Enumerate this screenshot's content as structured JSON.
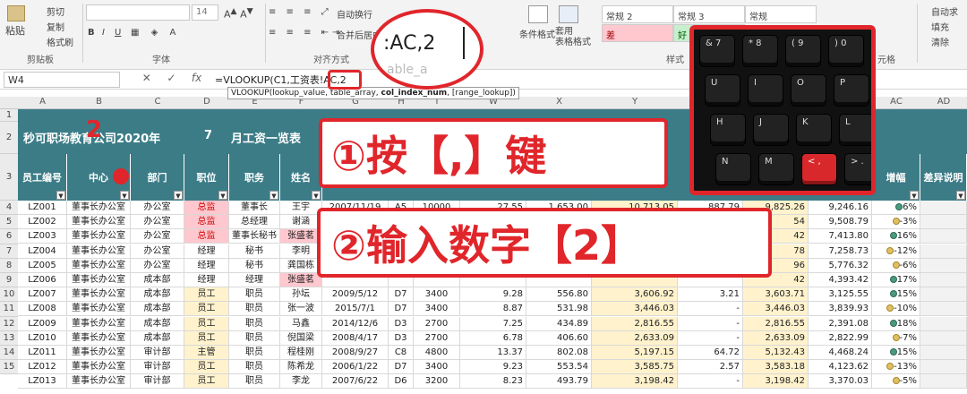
{
  "ribbon": {
    "clipboard": {
      "paste": "粘贴",
      "cut": "剪切",
      "copy": "复制",
      "format": "格式刷",
      "group": "剪贴板"
    },
    "font": {
      "size": "14",
      "group": "字体",
      "bold": "B",
      "italic": "I",
      "underline": "U"
    },
    "align": {
      "wrap": "自动换行",
      "merge": "合并后居中",
      "group": "对齐方式"
    },
    "styles": {
      "cond": "条件格式",
      "table": "套用\n表格格式",
      "normal2": "常规 2",
      "normal3": "常规 3",
      "normal": "常规",
      "bad": "差",
      "good": "好",
      "group": "样式"
    },
    "cells": {
      "autosum": "自动求",
      "fill": "填充",
      "clear": "清除",
      "group": "元格"
    }
  },
  "formula": {
    "namebox": "W4",
    "text": "=VLOOKUP(C1,工资表!AC,2",
    "tooltip_pre": "VLOOKUP(lookup_value, ",
    "tooltip_mid": "table_array, ",
    "tooltip_bold": "col_index_num",
    "tooltip_post": ", [range_lookup])",
    "fx": "fx",
    "cancel": "✕",
    "enter": "✓"
  },
  "columns": [
    "A",
    "B",
    "C",
    "D",
    "E",
    "F",
    "G",
    "H",
    "I",
    "W",
    "X",
    "Y",
    "Z",
    "AA",
    "AB",
    "AC",
    "AD"
  ],
  "row_numbers": [
    "1",
    "2",
    "3",
    "4",
    "5",
    "6",
    "7",
    "8",
    "9",
    "10",
    "11",
    "12",
    "13",
    "14",
    "15"
  ],
  "title": {
    "company": "秒可职场教育公司2020年",
    "month": "7",
    "suffix": "月工资一览表"
  },
  "headers": {
    "id": "员工编号",
    "center": "中心",
    "dept": "部门",
    "post": "职位",
    "duty": "职务",
    "name": "姓名",
    "growth": "增幅",
    "note": "差异说明"
  },
  "rows": [
    [
      "LZ001",
      "董事长办公室",
      "办公室",
      "总监",
      "董事长",
      "王宇",
      "2007/11/19",
      "A5",
      "10000",
      "27.55",
      "1,653.00",
      "10,713.05",
      "887.79",
      "9,825.26",
      "9,246.16",
      "6%"
    ],
    [
      "LZ002",
      "董事长办公室",
      "办公室",
      "总监",
      "总经理",
      "谢涵",
      "",
      "",
      "",
      "",
      "",
      "",
      "",
      "54",
      "9,508.79",
      "-3%"
    ],
    [
      "LZ003",
      "董事长办公室",
      "办公室",
      "总监",
      "董事长秘书",
      "张盛茗",
      "",
      "",
      "",
      "",
      "",
      "",
      "",
      "42",
      "7,413.80",
      "16%"
    ],
    [
      "LZ004",
      "董事长办公室",
      "办公室",
      "经理",
      "秘书",
      "李明",
      "",
      "",
      "",
      "",
      "",
      "",
      "",
      "78",
      "7,258.73",
      "-12%"
    ],
    [
      "LZ005",
      "董事长办公室",
      "办公室",
      "经理",
      "秘书",
      "龚国栋",
      "",
      "",
      "",
      "",
      "",
      "",
      "",
      "96",
      "5,776.32",
      "-6%"
    ],
    [
      "LZ006",
      "董事长办公室",
      "成本部",
      "经理",
      "经理",
      "张盛茗",
      "",
      "",
      "",
      "",
      "",
      "",
      "",
      "42",
      "4,393.42",
      "17%"
    ],
    [
      "LZ007",
      "董事长办公室",
      "成本部",
      "员工",
      "职员",
      "孙坛",
      "2009/5/12",
      "D7",
      "3400",
      "9.28",
      "556.80",
      "3,606.92",
      "3.21",
      "3,603.71",
      "3,125.55",
      "15%"
    ],
    [
      "LZ008",
      "董事长办公室",
      "成本部",
      "员工",
      "职员",
      "张一波",
      "2015/7/1",
      "D7",
      "3400",
      "8.87",
      "531.98",
      "3,446.03",
      "-",
      "3,446.03",
      "3,839.93",
      "-10%"
    ],
    [
      "LZ009",
      "董事长办公室",
      "成本部",
      "员工",
      "职员",
      "马鑫",
      "2014/12/6",
      "D3",
      "2700",
      "7.25",
      "434.89",
      "2,816.55",
      "-",
      "2,816.55",
      "2,391.08",
      "18%"
    ],
    [
      "LZ010",
      "董事长办公室",
      "成本部",
      "员工",
      "职员",
      "倪国梁",
      "2008/4/17",
      "D3",
      "2700",
      "6.78",
      "406.60",
      "2,633.09",
      "-",
      "2,633.09",
      "2,822.99",
      "-7%"
    ],
    [
      "LZ011",
      "董事长办公室",
      "审计部",
      "主管",
      "职员",
      "程桂刚",
      "2008/9/27",
      "C8",
      "4800",
      "13.37",
      "802.08",
      "5,197.15",
      "64.72",
      "5,132.43",
      "4,468.24",
      "15%"
    ],
    [
      "LZ012",
      "董事长办公室",
      "审计部",
      "员工",
      "职员",
      "陈希龙",
      "2006/1/22",
      "D7",
      "3400",
      "9.23",
      "553.54",
      "3,585.75",
      "2.57",
      "3,583.18",
      "4,123.62",
      "-13%"
    ],
    [
      "LZ013",
      "董事长办公室",
      "审计部",
      "员工",
      "职员",
      "李龙",
      "2007/6/22",
      "D6",
      "3200",
      "8.23",
      "493.79",
      "3,198.42",
      "-",
      "3,198.42",
      "3,370.03",
      "-5%"
    ]
  ],
  "overlay": {
    "badge": "2",
    "step1": "①按【,】键",
    "step2": "②输入数字【2】",
    "bubble": ":AC,2",
    "bubble_ghost": "able_a"
  },
  "keyboard": {
    "row1": [
      "& 7",
      "* 8",
      "( 9",
      ") 0"
    ],
    "row2": [
      "U",
      "I",
      "O",
      "P"
    ],
    "row3": [
      "H",
      "J",
      "K",
      "L"
    ],
    "row4": [
      "N",
      "M",
      "< ,",
      "> ."
    ]
  },
  "colors": {
    "header": "#3b7c87",
    "accent": "#e0262b"
  }
}
